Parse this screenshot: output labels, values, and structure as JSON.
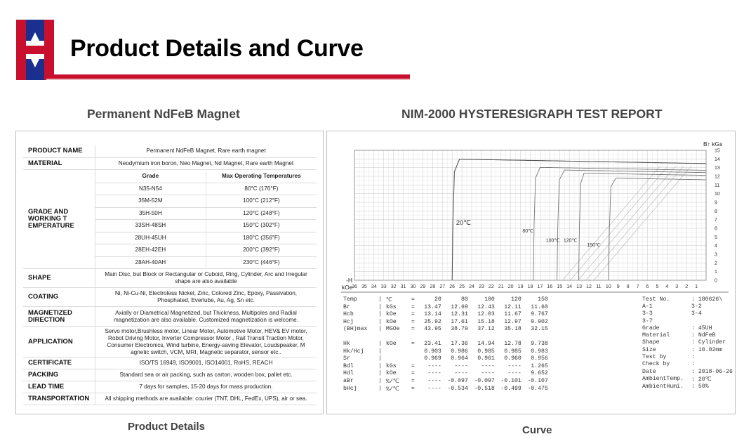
{
  "header": {
    "title": "Product Details and Curve",
    "brand_colors": {
      "red": "#c8102e",
      "blue": "#1b2f8f"
    }
  },
  "left": {
    "heading": "Permanent NdFeB Magnet",
    "caption": "Product Details",
    "rows": [
      {
        "label": "PRODUCT NAME",
        "value": "Permanent NdFeB Magnet, Rare earth magnet"
      },
      {
        "label": "MATERIAL",
        "value": "Neodymium iron boron, Neo Magnet, Nd Magnet, Rare earth Magnet"
      }
    ],
    "grade": {
      "label": "GRADE AND WORKING T EMPERATURE",
      "col_grade": "Grade",
      "col_temp": "Max Operating Temperatures",
      "items": [
        {
          "grade": "N35-N54",
          "temp": "80°C (176°F)"
        },
        {
          "grade": "35M-52M",
          "temp": "100°C (212°F)"
        },
        {
          "grade": "35H-50H",
          "temp": "120°C (248°F)"
        },
        {
          "grade": "33SH-48SH",
          "temp": "150°C (302°F)"
        },
        {
          "grade": "28UH-45UH",
          "temp": "180°C (356°F)"
        },
        {
          "grade": "28EH-42EH",
          "temp": "200°C (392°F)"
        },
        {
          "grade": "28AH-40AH",
          "temp": "230°C (446°F)"
        }
      ]
    },
    "rows2": [
      {
        "label": "SHAPE",
        "value": "Main Disc, but Block or Rectangular or Cuboid, Ring, Cylinder, Arc and Irregular shape are also available"
      },
      {
        "label": "COATING",
        "value": "Ni, Ni-Cu-Ni, Electroless Nickel, Zinc, Colored Zinc, Epoxy, Passivation, Phosphated, Everlube, Au, Ag, Sn etc."
      },
      {
        "label": "MAGNETIZED DIRECTION",
        "value": "Axially or Diametrical Magnetized, but Thickness, Multipoles and Radial magnetization are also available, Customized magnetization is welcome."
      },
      {
        "label": "APPLICATION",
        "value": "Servo motor,Brushless motor, Linear Motor, Automotive Motor, HEV& EV motor, Robot Driving Motor, Inverter Compressor Motor , Rail Transit Traction Motor, Consumer Electronics, Wind turbine, Energy-saving Elevator, Loudspeaker, M agnetic switch, VCM, MRI, Magnetic separator, sensor etc.."
      },
      {
        "label": "CERTIFICATE",
        "value": "ISO/TS 16949, ISO9001, ISO14001, RoHS, REACH"
      },
      {
        "label": "PACKING",
        "value": "Standard sea or air packing, such as carton, wooden box, pallet etc."
      },
      {
        "label": "LEAD TIME",
        "value": "7 days for samples, 15-20 days for mass production."
      },
      {
        "label": "TRANSPORTATION",
        "value": "All shipping methods are available: courier (TNT, DHL, FedEx, UPS), air or sea."
      }
    ]
  },
  "right": {
    "heading": "NIM-2000 HYSTERESIGRAPH TEST REPORT",
    "caption": "Curve",
    "report_rows": [
      [
        "Temp",
        "|",
        "℃",
        "=",
        "20",
        "80",
        "100",
        "120",
        "150"
      ],
      [
        "Br",
        "|",
        "kGs",
        "=",
        "13.47",
        "12.69",
        "12.43",
        "12.11",
        "11.60"
      ],
      [
        "Hcb",
        "|",
        "kOe",
        "=",
        "13.14",
        "12.31",
        "12.03",
        "11.67",
        "9.767"
      ],
      [
        "Hcj",
        "|",
        "kOe",
        "=",
        "25.92",
        "17.61",
        "15.18",
        "12.97",
        "9.902"
      ],
      [
        "(BH)max",
        "|",
        "MGOe",
        "=",
        "43.95",
        "38.79",
        "37.12",
        "35.18",
        "32.15"
      ],
      [
        "",
        "",
        "",
        "",
        "",
        "",
        "",
        "",
        ""
      ],
      [
        "Hk",
        "|",
        "kOe",
        "=",
        "23.41",
        "17.36",
        "14.94",
        "12.78",
        "9.738"
      ],
      [
        "Hk/Hcj",
        "|",
        "",
        "",
        "0.903",
        "0.986",
        "0.985",
        "0.985",
        "0.983"
      ],
      [
        "Sr",
        "|",
        "",
        "",
        "0.969",
        "0.964",
        "0.961",
        "0.960",
        "0.956"
      ],
      [
        "Bdl",
        "|",
        "kGs",
        "=",
        "----",
        "----",
        "----",
        "----",
        "1.265"
      ],
      [
        "Hdl",
        "|",
        "kOe",
        "=",
        "----",
        "----",
        "----",
        "----",
        "9.652"
      ],
      [
        "aBr",
        "|",
        "%/℃",
        "=",
        "----",
        "-0.097",
        "-0.097",
        "-0.101",
        "-0.107"
      ],
      [
        "bHcj",
        "|",
        "%/℃",
        "=",
        "----",
        "-0.534",
        "-0.518",
        "-0.499",
        "-0.475"
      ]
    ],
    "info_rows": [
      [
        "Test No.",
        ": 180626\\"
      ],
      [
        "A-1",
        "  3-2"
      ],
      [
        "3-3",
        "  3-4"
      ],
      [
        "3-7",
        ""
      ],
      [
        "Grade",
        ": 45UH"
      ],
      [
        "Material",
        ": NdFeB"
      ],
      [
        "Shape",
        ": Cylinder"
      ],
      [
        "Size",
        ": 10.02mm"
      ],
      [
        "Test by",
        ":"
      ],
      [
        "Check by",
        ":"
      ],
      [
        "Date",
        ": 2018-06-26"
      ],
      [
        "AmbientTemp.",
        ": 20℃"
      ],
      [
        "AmbientHumi.",
        ": 50%"
      ]
    ],
    "chart_data": {
      "type": "line",
      "title": "",
      "xlabel": "-H kOe",
      "ylabel": "B kGs",
      "xlim": [
        36,
        0
      ],
      "ylim": [
        0,
        15
      ],
      "x_ticks": [
        36,
        35,
        34,
        33,
        32,
        31,
        30,
        29,
        28,
        27,
        26,
        25,
        24,
        23,
        22,
        21,
        20,
        19,
        18,
        17,
        16,
        15,
        14,
        13,
        12,
        11,
        10,
        9,
        8,
        7,
        6,
        5,
        4,
        3,
        2,
        1
      ],
      "y_ticks": [
        0,
        1,
        2,
        3,
        4,
        5,
        6,
        7,
        8,
        9,
        10,
        11,
        12,
        13,
        14,
        15
      ],
      "grid": true,
      "series": [
        {
          "name": "20℃",
          "Br": 13.47,
          "Hcb": 13.14,
          "Hcj": 25.92
        },
        {
          "name": "80℃",
          "Br": 12.69,
          "Hcb": 12.31,
          "Hcj": 17.61
        },
        {
          "name": "100℃",
          "Br": 12.43,
          "Hcb": 12.03,
          "Hcj": 15.18
        },
        {
          "name": "120℃",
          "Br": 12.11,
          "Hcb": 11.67,
          "Hcj": 12.97
        },
        {
          "name": "150℃",
          "Br": 11.6,
          "Hcb": 9.767,
          "Hcj": 9.902
        }
      ]
    }
  }
}
